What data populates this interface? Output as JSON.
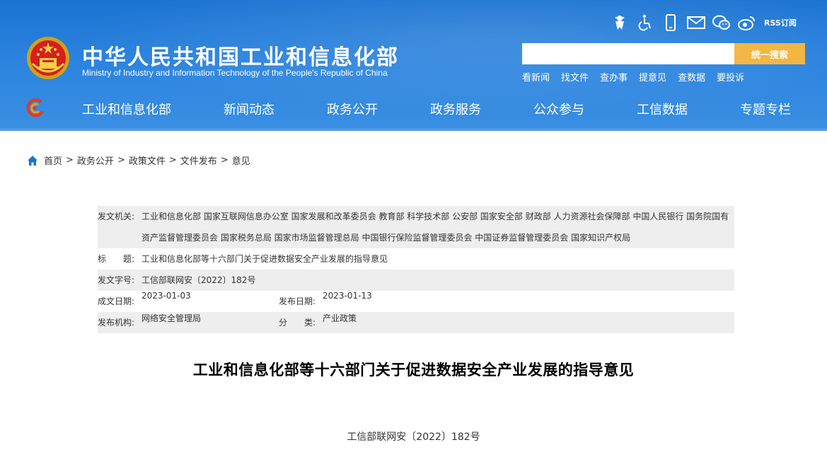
{
  "header": {
    "title": "中华人民共和国工业和信息化部",
    "subtitle": "Ministry of Industry and Information Technology of the People's Republic of China",
    "toolbar_icons": [
      "elderly-mode-icon",
      "accessibility-icon",
      "mobile-icon",
      "mail-icon",
      "wechat-icon",
      "weibo-icon"
    ],
    "rss_label": "RSS订阅",
    "search": {
      "placeholder": "",
      "button_label": "统一搜索"
    },
    "quick_links": [
      "看新闻",
      "找文件",
      "查办事",
      "提意见",
      "查数据",
      "要投诉"
    ],
    "nav": [
      "工业和信息化部",
      "新闻动态",
      "政务公开",
      "政务服务",
      "公众参与",
      "工信数据",
      "专题专栏"
    ],
    "colors": {
      "header_blue": "#2b83de",
      "search_button": "#f2b33d"
    }
  },
  "breadcrumb": [
    "首页",
    "政务公开",
    "政策文件",
    "文件发布",
    "意见"
  ],
  "meta": {
    "issuer_label": "发文机关:",
    "issuer_value": "工业和信息化部 国家互联网信息办公室 国家发展和改革委员会 教育部 科学技术部 公安部 国家安全部 财政部 人力资源社会保障部 中国人民银行 国务院国有资产监督管理委员会 国家税务总局 国家市场监督管理总局 中国银行保险监督管理委员会 中国证券监督管理委员会 国家知识产权局",
    "title_label": "标　　题:",
    "title_value": "工业和信息化部等十六部门关于促进数据安全产业发展的指导意见",
    "docno_label": "发文字号:",
    "docno_value": "工信部联网安〔2022〕182号",
    "created_label": "成文日期:",
    "created_value": "2023-01-03",
    "published_label": "发布日期:",
    "published_value": "2023-01-13",
    "agency_label": "发布机构:",
    "agency_value": "网络安全管理局",
    "category_label": "分　　类:",
    "category_value": "产业政策"
  },
  "article": {
    "title": "工业和信息化部等十六部门关于促进数据安全产业发展的指导意见",
    "doc_number": "工信部联网安〔2022〕182号"
  }
}
